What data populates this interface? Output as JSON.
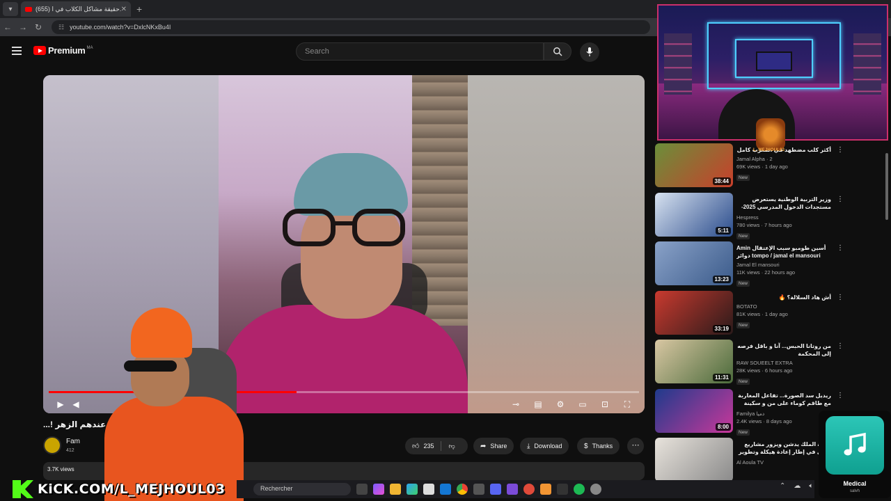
{
  "browser": {
    "tab_title": "(655) حقيقة مشاكل الكلاب في ا...",
    "url": "youtube.com/watch?v=DxlcNKxBu4I"
  },
  "youtube": {
    "brand": "Premium",
    "region": "MA",
    "search_placeholder": "Search"
  },
  "video": {
    "title": "...! عندهم الزهر",
    "channel": "Fam",
    "subs": "412",
    "views": "3.7K views",
    "progress": 0.42,
    "likes": "235",
    "share_label": "Share",
    "download_label": "Download",
    "thanks_label": "Thanks"
  },
  "recommendations": [
    {
      "title": "أكثر كلب مضطهد في المغرب كامل",
      "channel": "Jamal Alpha · 2",
      "stats": "69K views · 1 day ago",
      "badge": "New",
      "duration": "38:44",
      "rtl": true,
      "c1": "#6a8f3a",
      "c2": "#c93f2b"
    },
    {
      "title": "وزير التربية الوطنية يستعرض مستجدات الدخول المدرسي 2025-2026",
      "channel": "Hespress",
      "stats": "780 views · 7 hours ago",
      "badge": "New",
      "duration": "5:11",
      "rtl": true,
      "c1": "#d8e2f0",
      "c2": "#2a4c8c"
    },
    {
      "title": "Amin أسين طومبو سبب الإعتقال دوائر tompo / jamal el mansouri",
      "channel": "Jamal El mansouri",
      "stats": "11K views · 22 hours ago",
      "badge": "New",
      "duration": "13:23",
      "rtl": false,
      "c1": "#8aa2c8",
      "c2": "#3a5a8a"
    },
    {
      "title": "أش هاد السلالة؟ 🔥",
      "channel": "BOTATO",
      "stats": "81K views · 1 day ago",
      "badge": "New",
      "duration": "33:19",
      "rtl": true,
      "c1": "#c93a2f",
      "c2": "#2a1a1a"
    },
    {
      "title": "من روتانا الحبس... آنا و باقل فرصه إلى المحكمة",
      "channel": "RAW SOUEELT EXTRA",
      "stats": "28K views · 6 hours ago",
      "badge": "New",
      "duration": "11:31",
      "rtl": true,
      "c1": "#d9c7a3",
      "c2": "#4a6a3a"
    },
    {
      "title": "ريديل سد الصورة... تفاعل المغاربة مع طاقم كوماء على من و سكينة بنجلون",
      "channel": "Familya دميا",
      "stats": "2.4K views · 8 days ago",
      "badge": "New",
      "duration": "8:00",
      "rtl": true,
      "c1": "#1f3b8c",
      "c2": "#c9389a"
    },
    {
      "title": "جلالة الملك يدشن ويزور مشاريع كبرى في إطار إعادة هيكلة وتطوير المركب",
      "channel": "Al Aoula TV",
      "stats": "",
      "badge": "",
      "duration": "",
      "rtl": true,
      "c1": "#e8e3dc",
      "c2": "#8a8a8a"
    }
  ],
  "overlay": {
    "kick": "KiCK.COM/L_MEJHOUL03",
    "streamer_tag": "L_MEJHOUL03"
  },
  "taskbar": {
    "search": "Rechercher"
  },
  "music": {
    "track": "Medical",
    "artist": "salvh"
  }
}
